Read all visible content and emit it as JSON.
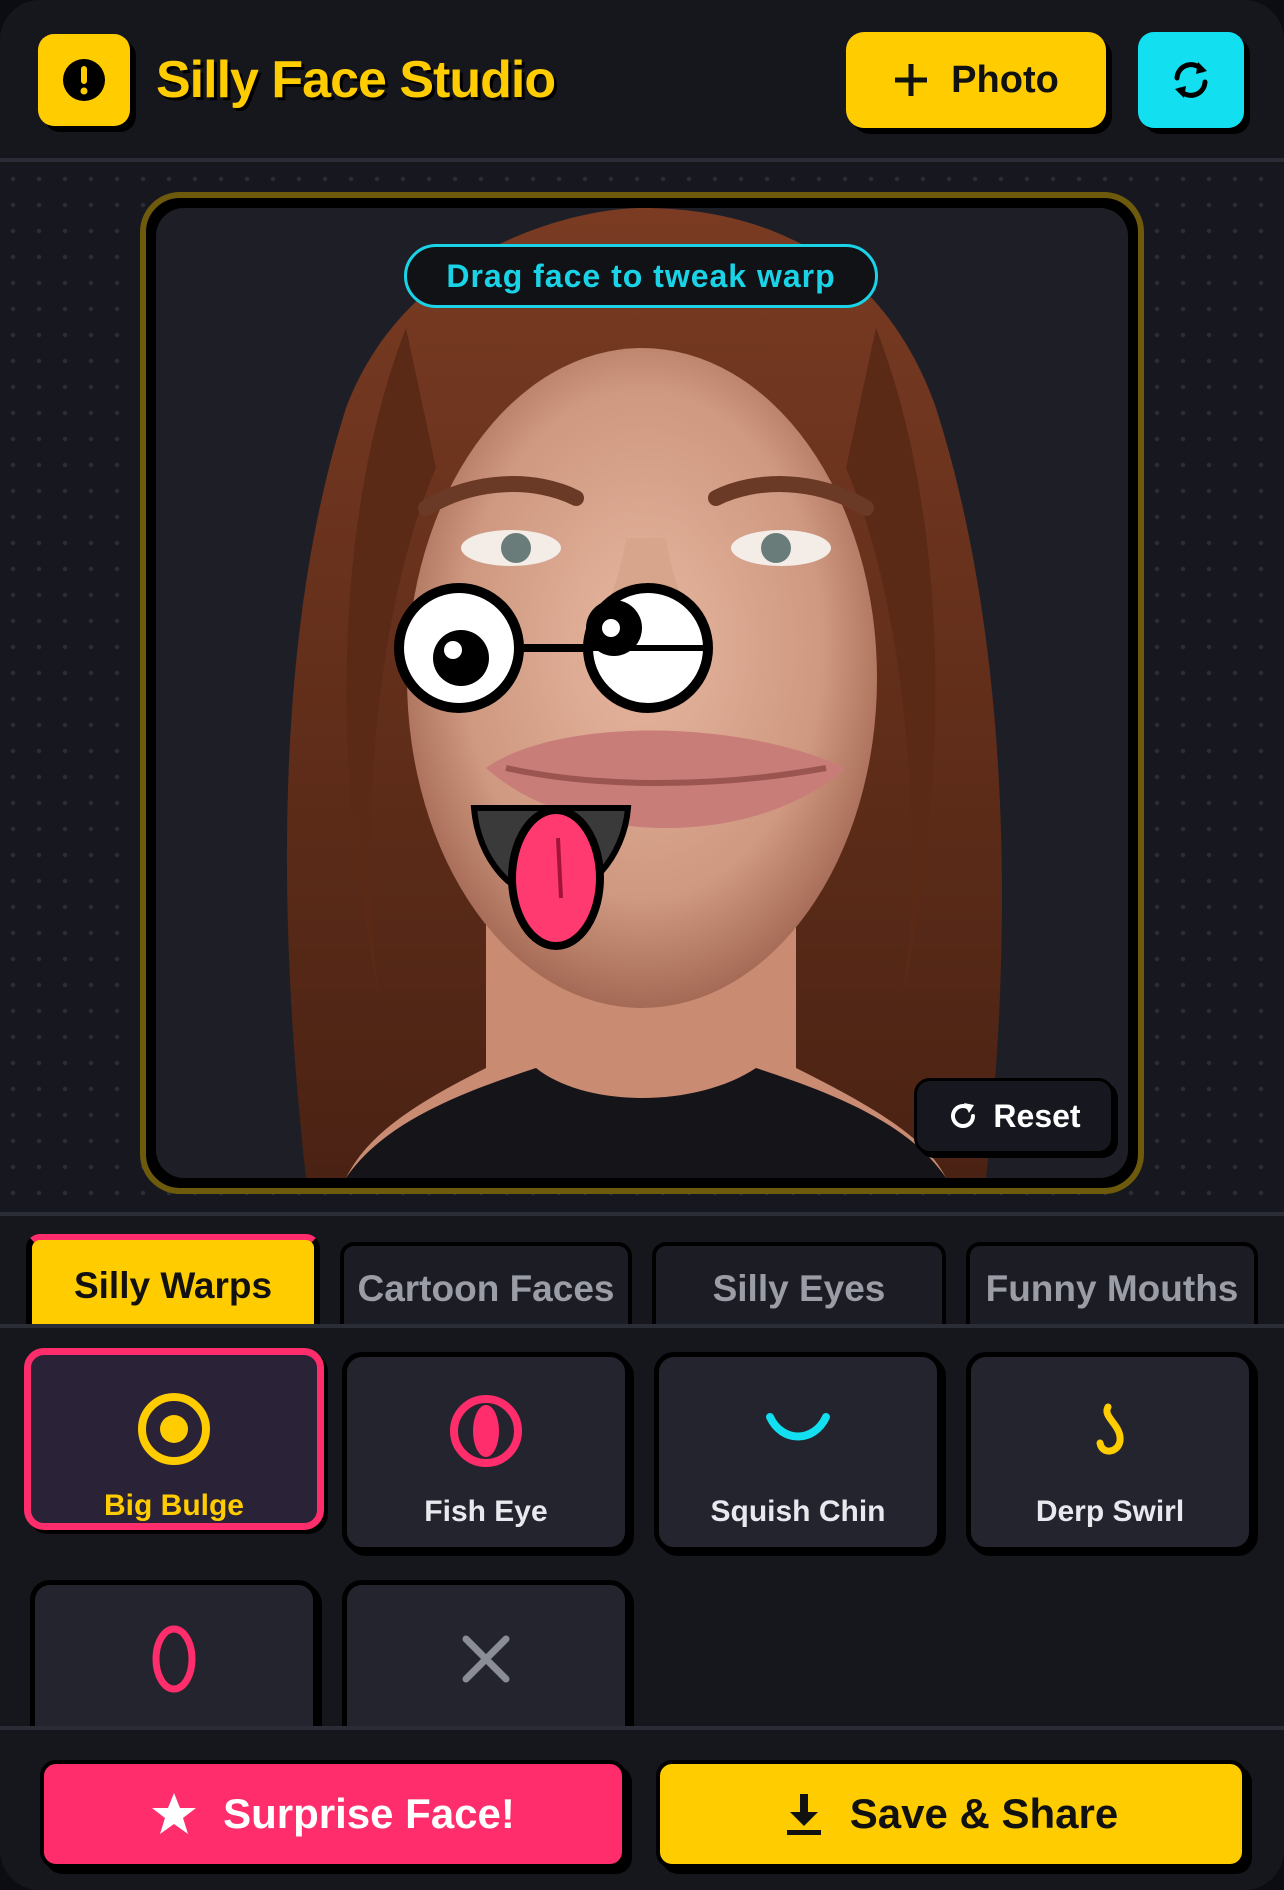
{
  "header": {
    "title": "Silly Face Studio",
    "logo_icon": "alert-circle-icon",
    "photo_button_label": "Photo",
    "photo_button_icon": "plus-icon",
    "swap_button_icon": "swap-camera-icon"
  },
  "stage": {
    "hint": "Drag face to tweak warp",
    "reset_label": "Reset",
    "reset_icon": "rotate-icon",
    "overlays": [
      "googly-eyes",
      "cartoon-tongue-mouth"
    ]
  },
  "tabs": [
    {
      "label": "Silly Warps",
      "active": true
    },
    {
      "label": "Cartoon Faces",
      "active": false
    },
    {
      "label": "Silly Eyes",
      "active": false
    },
    {
      "label": "Funny Mouths",
      "active": false
    }
  ],
  "effects": [
    {
      "label": "Big Bulge",
      "icon": "bulge-target-icon",
      "selected": true
    },
    {
      "label": "Fish Eye",
      "icon": "fish-eye-icon",
      "selected": false
    },
    {
      "label": "Squish Chin",
      "icon": "smile-curve-icon",
      "selected": false
    },
    {
      "label": "Derp Swirl",
      "icon": "swirl-icon",
      "selected": false
    },
    {
      "label": "",
      "icon": "zero-oval-icon",
      "selected": false
    },
    {
      "label": "",
      "icon": "close-x-icon",
      "selected": false
    }
  ],
  "actions": {
    "surprise_label": "Surprise Face!",
    "surprise_icon": "star-icon",
    "save_label": "Save & Share",
    "save_icon": "download-icon"
  },
  "colors": {
    "accent_yellow": "#ffcc00",
    "accent_pink": "#ff2d6b",
    "accent_cyan": "#12e0f0",
    "background": "#16171d"
  }
}
